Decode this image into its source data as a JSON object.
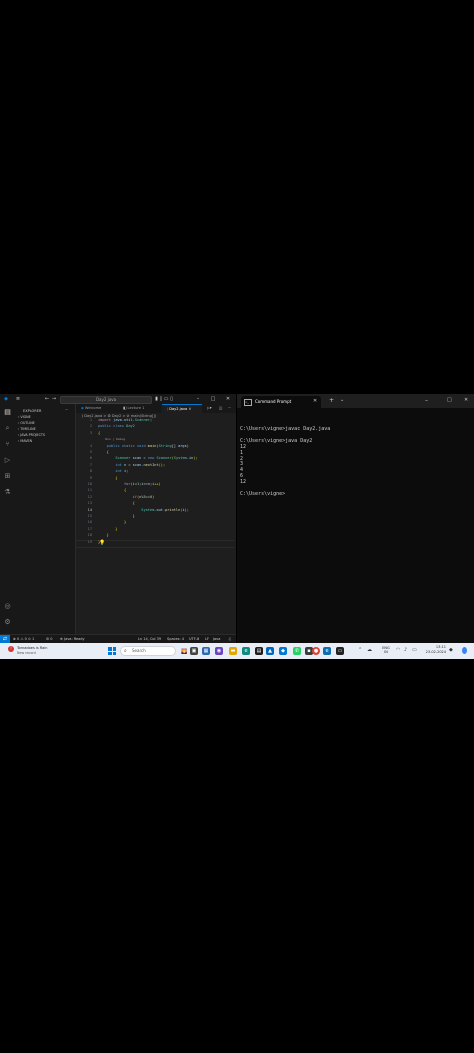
{
  "vscode": {
    "title_search": "Day2 java",
    "explorer": {
      "header": "EXPLORER",
      "sections": [
        "VIGNE",
        "OUTLINE",
        "TIMELINE",
        "JAVA PROJECTS",
        "MAVEN"
      ]
    },
    "tabs": [
      {
        "label": "Welcome",
        "active": false
      },
      {
        "label": "Lecture 1",
        "active": false
      },
      {
        "label": "Day2.java",
        "active": true
      }
    ],
    "breadcrumb": "J Day2.java > ⚙ Day2 > ⊘ main(String[])",
    "code_lines": [
      {
        "num": "1",
        "text": "import java.util.Scanner;"
      },
      {
        "num": "2",
        "text": "public class Day2"
      },
      {
        "num": "3",
        "text": "{"
      },
      {
        "num": "",
        "text": "    Run | Debug"
      },
      {
        "num": "4",
        "text": "    public static void main(String[] args)"
      },
      {
        "num": "5",
        "text": "    {"
      },
      {
        "num": "6",
        "text": "        Scanner scan = new Scanner(System.in);"
      },
      {
        "num": "7",
        "text": "        int n = scan.nextInt();"
      },
      {
        "num": "8",
        "text": "        int i;"
      },
      {
        "num": "9",
        "text": "        {"
      },
      {
        "num": "10",
        "text": "            for(i=1;i<=n;i++)"
      },
      {
        "num": "11",
        "text": "            {"
      },
      {
        "num": "12",
        "text": "                if(n%5==0)"
      },
      {
        "num": "13",
        "text": "                {"
      },
      {
        "num": "14",
        "text": "                    System.out.println(i);"
      },
      {
        "num": "15",
        "text": "                }"
      },
      {
        "num": "16",
        "text": "            }"
      },
      {
        "num": "17",
        "text": "        }"
      },
      {
        "num": "18",
        "text": "    }"
      },
      {
        "num": "19",
        "text": "}"
      }
    ],
    "status": {
      "left": "⊗ 0 ⚠ 0  ⊙ 1",
      "git": "⚙ 0",
      "java": "⊕ Java: Ready",
      "position": "Ln 14, Col 39",
      "spaces": "Spaces: 4",
      "encoding": "UTF-8",
      "eol": "LF",
      "language": "Java"
    }
  },
  "cmd": {
    "tab_title": "Command Prompt",
    "output": "C:\\Users\\vigne>javac Day2.java\n\nC:\\Users\\vigne>java Day2\n12\n1\n2\n3\n4\n6\n12\n\nC:\\Users\\vigne>"
  },
  "taskbar": {
    "notification_title": "Tornadoes is Rain",
    "notification_sub": "New record",
    "search_placeholder": "Search",
    "lang_top": "ENG",
    "lang_bottom": "IN",
    "time": "13:11",
    "date": "23-02-2024"
  },
  "colors": {
    "accent": "#0078d4",
    "keyword": "#569cd6",
    "control": "#c586c0",
    "type": "#4ec9b0",
    "function": "#dcdcaa",
    "variable": "#9cdcfe",
    "number": "#b5cea8"
  }
}
